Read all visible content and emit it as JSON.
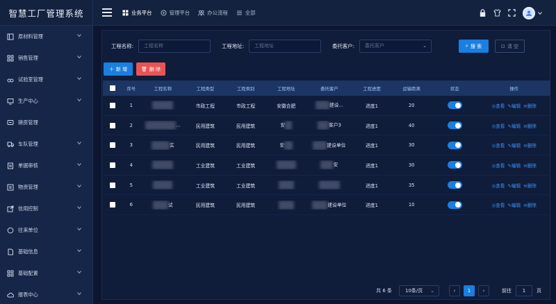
{
  "brand": "智慧工厂管理系统",
  "sidebar": {
    "items": [
      {
        "label": "原材料管理",
        "icon": "box-icon",
        "has_children": true
      },
      {
        "label": "销售管理",
        "icon": "grid-icon",
        "has_children": true
      },
      {
        "label": "试验室管理",
        "icon": "glasses-icon",
        "has_children": true
      },
      {
        "label": "生产中心",
        "icon": "monitor-icon",
        "has_children": true
      },
      {
        "label": "磅房管理",
        "icon": "message-icon",
        "has_children": false
      },
      {
        "label": "车队管理",
        "icon": "truck-icon",
        "has_children": true
      },
      {
        "label": "单据审核",
        "icon": "document-icon",
        "has_children": true
      },
      {
        "label": "物资管理",
        "icon": "list-icon",
        "has_children": true
      },
      {
        "label": "信用控制",
        "icon": "export-icon",
        "has_children": true
      },
      {
        "label": "往来单位",
        "icon": "chat-icon",
        "has_children": true
      },
      {
        "label": "基础信息",
        "icon": "doc-icon",
        "has_children": true
      },
      {
        "label": "基础配置",
        "icon": "grid-icon",
        "has_children": true
      },
      {
        "label": "报表中心",
        "icon": "cloud-icon",
        "has_children": true
      }
    ]
  },
  "topbar": {
    "tabs": [
      {
        "label": "业务平台",
        "icon": "apps-icon",
        "active": true
      },
      {
        "label": "管理平台",
        "icon": "gear-icon",
        "active": false
      },
      {
        "label": "办公流程",
        "icon": "users-icon",
        "active": false
      },
      {
        "label": "全部",
        "icon": "list-icon",
        "active": false
      }
    ]
  },
  "filters": {
    "name_label": "工程名称:",
    "name_placeholder": "工程名称",
    "addr_label": "工程地址:",
    "addr_placeholder": "工程地址",
    "client_label": "委托客户:",
    "client_placeholder": "委托客户",
    "search_btn": "搜 索",
    "clear_btn": "清 空"
  },
  "actions": {
    "add": "新 增",
    "delete": "删 除"
  },
  "table": {
    "headers": [
      "序号",
      "工程名称",
      "工程类型",
      "工程类别",
      "工程地址",
      "委托客户",
      "工程进度",
      "运输距离",
      "状态",
      "操作"
    ],
    "ops": [
      "查看",
      "编辑",
      "删除"
    ],
    "rows": [
      {
        "idx": "1",
        "name": "",
        "type": "市政工程",
        "cat": "市政工程",
        "addr": "安徽合肥",
        "client": "建设...",
        "prog": "进度1",
        "dist": "20",
        "on": true
      },
      {
        "idx": "2",
        "name": "...",
        "type": "民用建筑",
        "cat": "民用建筑",
        "addr": "安",
        "client": "客户3",
        "prog": "进度1",
        "dist": "40",
        "on": true
      },
      {
        "idx": "3",
        "name": "实",
        "type": "民用建筑",
        "cat": "民用建筑",
        "addr": "安",
        "client": "建设单位",
        "prog": "进度1",
        "dist": "30",
        "on": true
      },
      {
        "idx": "4",
        "name": "",
        "type": "工业建筑",
        "cat": "工业建筑",
        "addr": "",
        "client": "安",
        "prog": "进度1",
        "dist": "30",
        "on": true
      },
      {
        "idx": "5",
        "name": "",
        "type": "工业建筑",
        "cat": "工业建筑",
        "addr": "",
        "client": "",
        "prog": "进度1",
        "dist": "35",
        "on": true
      },
      {
        "idx": "6",
        "name": "试",
        "type": "民用建筑",
        "cat": "民用建筑",
        "addr": "",
        "client": "建设单位",
        "prog": "进度1",
        "dist": "10",
        "on": true
      }
    ]
  },
  "pagination": {
    "total": "共 6 条",
    "page_size": "10条/页",
    "current_page": "1",
    "jump_label": "前往",
    "jump_value": "1",
    "page_unit": "页"
  },
  "colors": {
    "primary": "#1a7fe0",
    "danger": "#e85454",
    "sidebar_bg": "#162648",
    "panel_bg": "#0f1c3a"
  }
}
